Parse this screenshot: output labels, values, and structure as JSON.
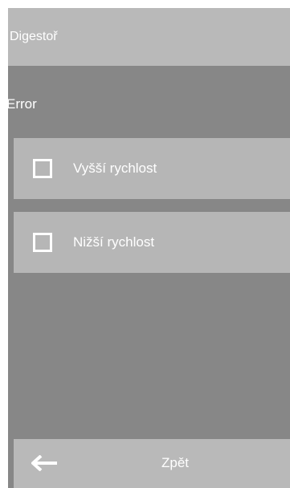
{
  "header": {
    "title": "Digestoř"
  },
  "status": {
    "text": "Error"
  },
  "options": [
    {
      "label": "Vyšší rychlost",
      "checked": false
    },
    {
      "label": "Nižší rychlost",
      "checked": false
    }
  ],
  "footer": {
    "back_label": "Zpět",
    "back_icon": "arrow-left-icon"
  },
  "colors": {
    "background": "#878787",
    "header": "#b9b9b9",
    "option": "#b6b6b6",
    "text": "#ffffff"
  }
}
